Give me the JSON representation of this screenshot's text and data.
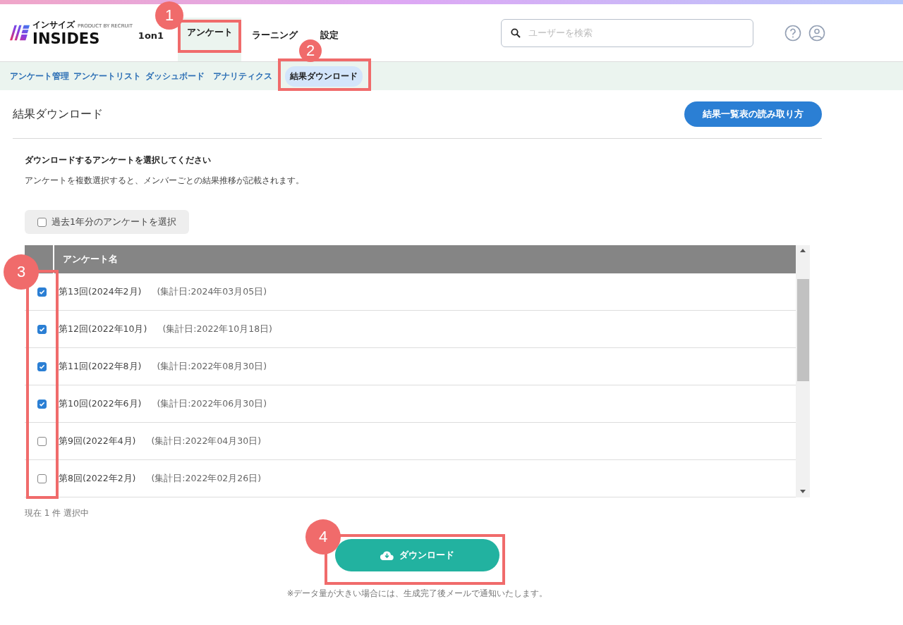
{
  "header": {
    "logo": {
      "kana": "インサイズ",
      "name": "INSIDES",
      "tagline": "PRODUCT BY RECRUIT"
    },
    "nav": [
      {
        "label": "1on1",
        "selected": false
      },
      {
        "label": "アンケート",
        "selected": true
      },
      {
        "label": "ラーニング",
        "selected": false
      },
      {
        "label": "設定",
        "selected": false
      }
    ],
    "search": {
      "placeholder": "ユーザーを検索"
    }
  },
  "subnav": [
    {
      "label": "アンケート管理",
      "selected": false
    },
    {
      "label": "アンケートリスト",
      "selected": false
    },
    {
      "label": "ダッシュボード",
      "selected": false
    },
    {
      "label": "アナリティクス",
      "selected": false
    },
    {
      "label": "結果ダウンロード",
      "selected": true
    }
  ],
  "page": {
    "title": "結果ダウンロード",
    "help_button": "結果一覧表の読み取り方"
  },
  "section": {
    "heading": "ダウンロードするアンケートを選択してください",
    "description": "アンケートを複数選択すると、メンバーごとの結果推移が記載されます。",
    "past_year": {
      "label": "過去1年分のアンケートを選択",
      "checked": false
    }
  },
  "table": {
    "columns": [
      "アンケート名"
    ],
    "rows": [
      {
        "name": "第13回(2024年2月)",
        "date": "(集計日:2024年03月05日)",
        "checked": true
      },
      {
        "name": "第12回(2022年10月)",
        "date": "(集計日:2022年10月18日)",
        "checked": true
      },
      {
        "name": "第11回(2022年8月)",
        "date": "(集計日:2022年08月30日)",
        "checked": true
      },
      {
        "name": "第10回(2022年6月)",
        "date": "(集計日:2022年06月30日)",
        "checked": true
      },
      {
        "name": "第9回(2022年4月)",
        "date": "(集計日:2022年04月30日)",
        "checked": false
      },
      {
        "name": "第8回(2022年2月)",
        "date": "(集計日:2022年02月26日)",
        "checked": false
      }
    ]
  },
  "selection_count": "現在 1 件 選択中",
  "download_button": "ダウンロード",
  "note": "※データ量が大きい場合には、生成完了後メールで通知いたします。",
  "annotations": [
    {
      "label": "1"
    },
    {
      "label": "2"
    },
    {
      "label": "3"
    },
    {
      "label": "4"
    }
  ]
}
